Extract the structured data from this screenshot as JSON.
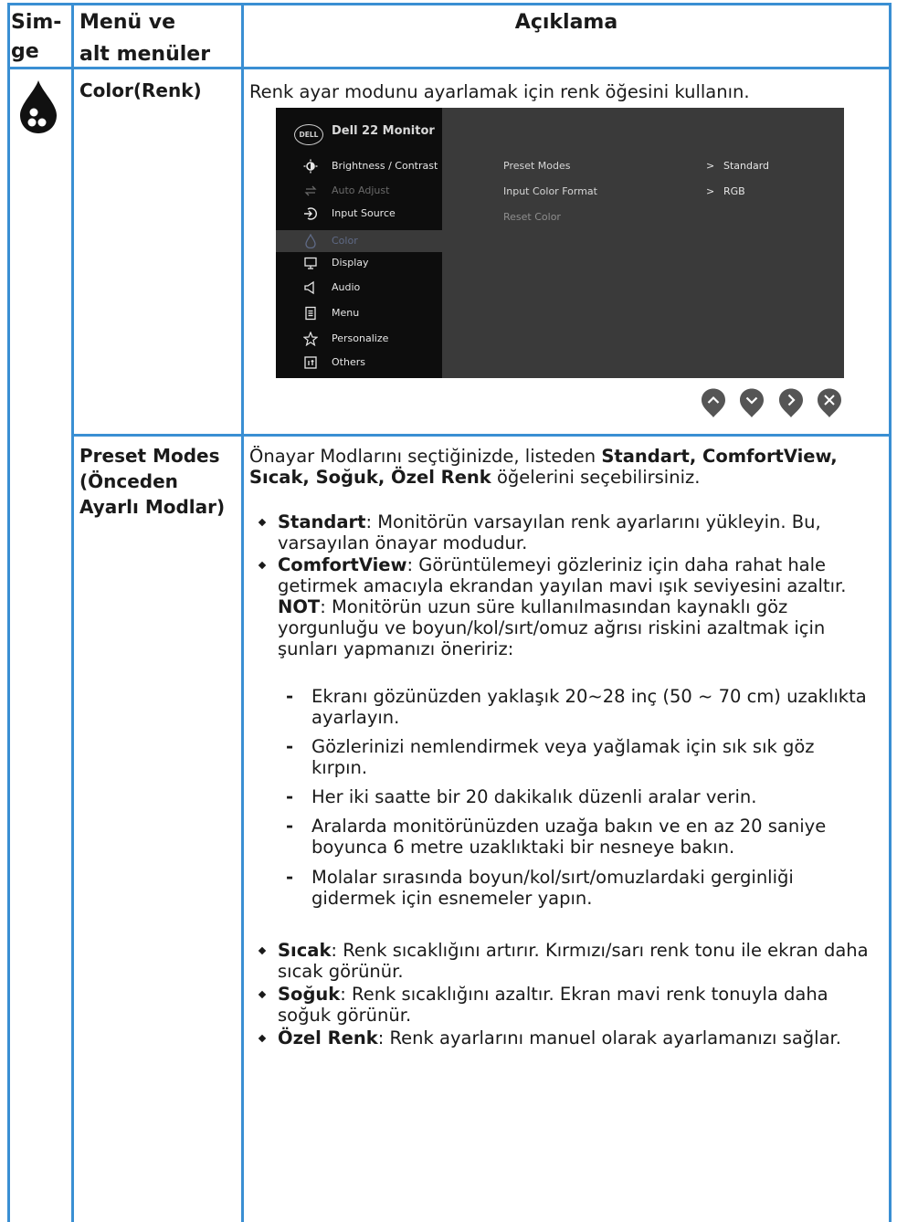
{
  "header": {
    "col1_line1": "Sim-",
    "col1_line2": "ge",
    "col2_line1": "Menü ve",
    "col2_line2": "alt menüler",
    "col3": "Açıklama"
  },
  "row_color": {
    "icon": "color-drop-icon",
    "title": "Color(Renk)",
    "description": "Renk ayar modunu ayarlamak için renk öğesini kullanın."
  },
  "osd": {
    "logo": "DELL",
    "title": "Dell 22 Monitor",
    "menu": [
      {
        "label": "Brightness / Contrast",
        "icon": "brightness-icon",
        "state": "normal"
      },
      {
        "label": "Auto Adjust",
        "icon": "auto-adjust-icon",
        "state": "disabled"
      },
      {
        "label": "Input Source",
        "icon": "input-source-icon",
        "state": "normal"
      },
      {
        "label": "Color",
        "icon": "color-icon",
        "state": "selected"
      },
      {
        "label": "Display",
        "icon": "display-icon",
        "state": "normal"
      },
      {
        "label": "Audio",
        "icon": "audio-icon",
        "state": "normal"
      },
      {
        "label": "Menu",
        "icon": "menu-icon",
        "state": "normal"
      },
      {
        "label": "Personalize",
        "icon": "star-icon",
        "state": "normal"
      },
      {
        "label": "Others",
        "icon": "others-icon",
        "state": "normal"
      }
    ],
    "submenu": [
      {
        "label": "Preset Modes",
        "arrow": ">",
        "value": "Standard"
      },
      {
        "label": "Input Color Format",
        "arrow": ">",
        "value": "RGB"
      },
      {
        "label": "Reset Color",
        "arrow": "",
        "value": ""
      }
    ],
    "nav_buttons": [
      "up-icon",
      "down-icon",
      "right-icon",
      "close-icon"
    ]
  },
  "row_preset": {
    "title_line1": "Preset Modes",
    "title_line2": "(Önceden",
    "title_line3": "Ayarlı Modlar)",
    "intro_a": "Önayar Modlarını seçtiğinizde, listeden ",
    "intro_b": "Standart, ComfortView,",
    "intro_c": "Sıcak, Soğuk, Özel Renk",
    "intro_d": " öğelerini seçebilirsiniz.",
    "b1_bold": "Standart",
    "b1_text": ": Monitörün varsayılan renk ayarlarını yükleyin. Bu, varsayılan önayar modudur.",
    "b2_bold": "ComfortView",
    "b2_text": ": Görüntülemeyi gözleriniz için daha rahat hale getirmek amacıyla ekrandan yayılan mavi ışık seviyesini azaltır.",
    "note_bold": "NOT",
    "note_text": ": Monitörün uzun süre kullanılmasından kaynaklı göz yorgunluğu ve boyun/kol/sırt/omuz ağrısı riskini azaltmak için şunları yapmanızı öneririz:",
    "dashes": [
      "Ekranı gözünüzden yaklaşık 20~28 inç (50 ~ 70 cm) uzaklıkta ayarlayın.",
      "Gözlerinizi nemlendirmek veya yağlamak için sık sık göz kırpın.",
      "Her iki saatte bir 20 dakikalık düzenli aralar verin.",
      "Aralarda monitörünüzden uzağa bakın ve en az 20 saniye boyunca 6 metre uzaklıktaki bir nesneye bakın.",
      "Molalar sırasında boyun/kol/sırt/omuzlardaki gerginliği gidermek için esnemeler yapın."
    ],
    "dash_mark": "-",
    "b3_bold": "Sıcak",
    "b3_text": ": Renk sıcaklığını artırır. Kırmızı/sarı renk tonu ile ekran daha sıcak görünür.",
    "b4_bold": "Soğuk",
    "b4_text": ": Renk sıcaklığını azaltır. Ekran mavi renk tonuyla daha soğuk görünür.",
    "b5_bold": "Özel Renk",
    "b5_text": ": Renk ayarlarını manuel olarak ayarlamanızı sağlar."
  },
  "colors": {
    "rule": "#3a8fd3",
    "osd_bg": "#3a3a3a",
    "osd_left": "#0d0d0d",
    "nav_button": "#555555"
  }
}
